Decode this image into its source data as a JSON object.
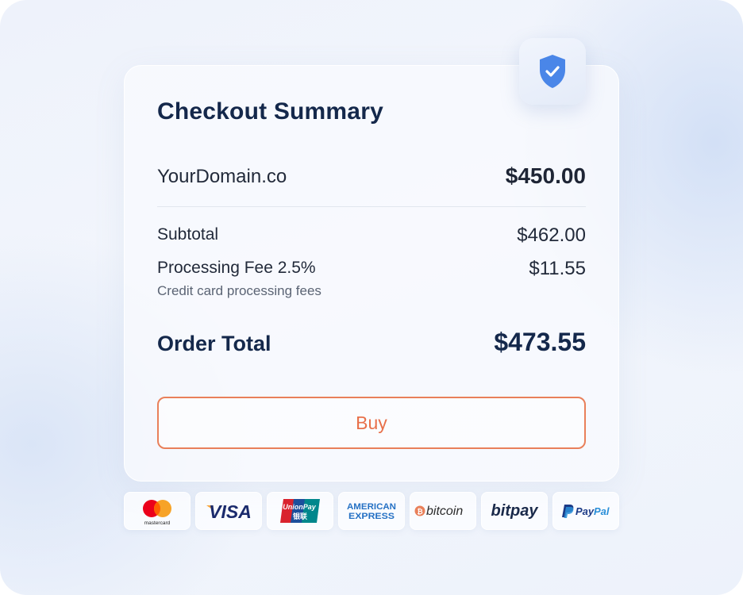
{
  "checkout": {
    "title": "Checkout Summary",
    "item": {
      "name": "YourDomain.co",
      "price": "$450.00"
    },
    "subtotal": {
      "label": "Subtotal",
      "value": "$462.00"
    },
    "fee": {
      "label": "Processing Fee 2.5%",
      "note": "Credit card processing fees",
      "value": "$11.55"
    },
    "total": {
      "label": "Order Total",
      "value": "$473.55"
    },
    "buy_label": "Buy"
  },
  "payment_methods": [
    {
      "icon": "mastercard-logo",
      "text": "mastercard"
    },
    {
      "icon": "visa-logo",
      "text": "VISA"
    },
    {
      "icon": "unionpay-logo",
      "text": "UnionPay 银联"
    },
    {
      "icon": "american-express-logo",
      "text": "AMERICAN EXPRESS"
    },
    {
      "icon": "bitcoin-logo",
      "text": "bitcoin"
    },
    {
      "icon": "bitpay-logo",
      "text": "bitpay"
    },
    {
      "icon": "paypal-logo",
      "text": "PayPal"
    }
  ],
  "colors": {
    "title": "#14284b",
    "accent": "#e8704a",
    "shield": "#4a86e8"
  }
}
